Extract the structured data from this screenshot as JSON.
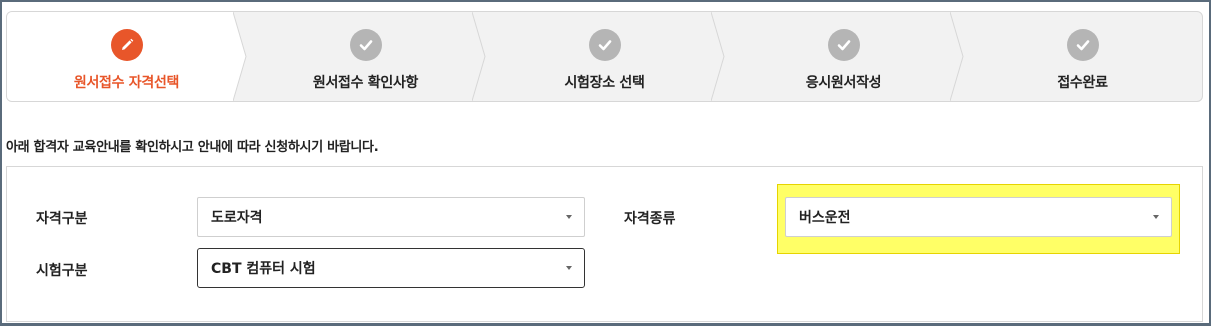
{
  "steps": [
    {
      "label": "원서접수 자격선택",
      "state": "active",
      "icon": "pencil-icon"
    },
    {
      "label": "원서접수 확인사항",
      "state": "done",
      "icon": "check-icon"
    },
    {
      "label": "시험장소 선택",
      "state": "done",
      "icon": "check-icon"
    },
    {
      "label": "응시원서작성",
      "state": "done",
      "icon": "check-icon"
    },
    {
      "label": "접수완료",
      "state": "done",
      "icon": "check-icon"
    }
  ],
  "notice": "아래 합격자 교육안내를 확인하시고 안내에 따라 신청하시기 바랍니다.",
  "form": {
    "qualification_category_label": "자격구분",
    "qualification_category_value": "도로자격",
    "qualification_type_label": "자격종류",
    "qualification_type_value": "버스운전",
    "exam_category_label": "시험구분",
    "exam_category_value": "CBT 컴퓨터 시험"
  },
  "colors": {
    "accent": "#e8562a",
    "done": "#b5b5b5",
    "highlight": "#ffff66"
  }
}
